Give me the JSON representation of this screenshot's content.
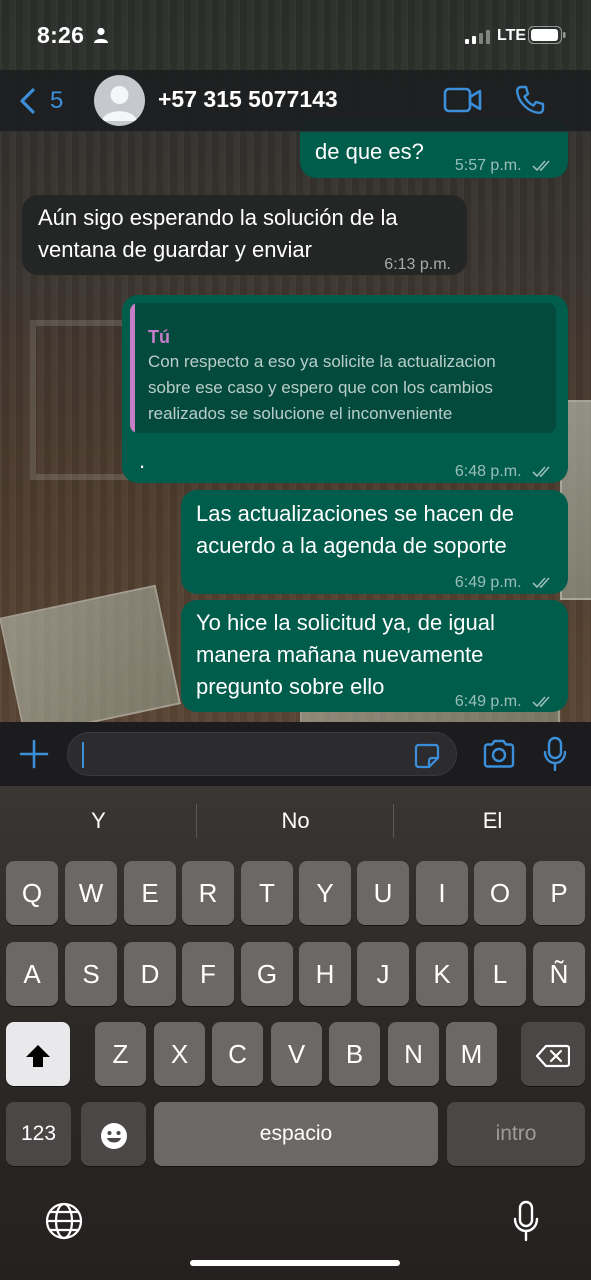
{
  "status_bar": {
    "time": "8:26",
    "network": "LTE"
  },
  "header": {
    "back_count": "5",
    "contact": "+57 315 5077143"
  },
  "messages": [
    {
      "direction": "out",
      "text": "de que es?",
      "time": "5:57 p.m.",
      "read": true
    },
    {
      "direction": "in",
      "lines": [
        "Aún sigo esperando la solución de la",
        "ventana de guardar y enviar"
      ],
      "time": "6:13 p.m."
    },
    {
      "direction": "out",
      "quote_author": "Tú",
      "quote_lines": [
        "Con respecto a eso ya solicite la actualizacion",
        "sobre ese caso y espero que con los cambios",
        "realizados se solucione el inconveniente"
      ],
      "text": ".",
      "time": "6:48 p.m.",
      "read": true
    },
    {
      "direction": "out",
      "lines": [
        "Las actualizaciones se hacen de",
        "acuerdo a la agenda de soporte"
      ],
      "time": "6:49 p.m.",
      "read": true
    },
    {
      "direction": "out",
      "lines": [
        "Yo hice la solicitud ya, de igual",
        "manera mañana nuevamente",
        "pregunto sobre ello"
      ],
      "time": "6:49 p.m.",
      "read": true
    }
  ],
  "input": {
    "value": ""
  },
  "keyboard": {
    "suggestions": [
      "Y",
      "No",
      "El"
    ],
    "row1": [
      "Q",
      "W",
      "E",
      "R",
      "T",
      "Y",
      "U",
      "I",
      "O",
      "P"
    ],
    "row2": [
      "A",
      "S",
      "D",
      "F",
      "G",
      "H",
      "J",
      "K",
      "L",
      "Ñ"
    ],
    "row3": [
      "Z",
      "X",
      "C",
      "V",
      "B",
      "N",
      "M"
    ],
    "numbers_label": "123",
    "space_label": "espacio",
    "return_label": "intro"
  },
  "icons": {
    "accent_color": "#3b8fd8",
    "outgoing_bubble_color": "#005c4b",
    "incoming_bubble_color": "#242626",
    "quote_author_color": "#c37ec6"
  }
}
